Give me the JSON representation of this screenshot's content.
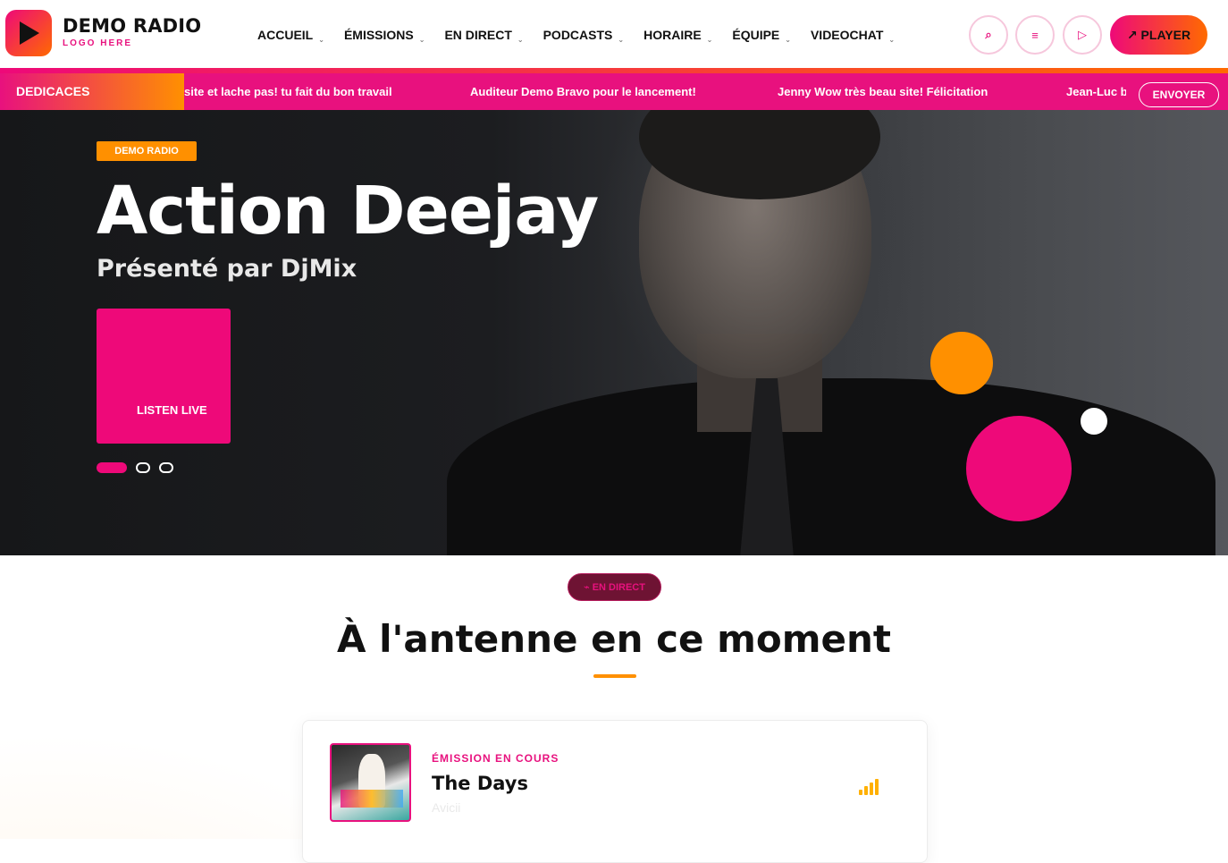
{
  "brand": {
    "name": "DEMO RADIO",
    "tagline": "LOGO HERE",
    "accent": "#e8117e",
    "accent2": "#ff9000"
  },
  "nav": [
    {
      "label": "ACCUEIL"
    },
    {
      "label": "ÉMISSIONS"
    },
    {
      "label": "EN DIRECT"
    },
    {
      "label": "PODCASTS"
    },
    {
      "label": "HORAIRE"
    },
    {
      "label": "ÉQUIPE"
    },
    {
      "label": "VIDEOCHAT"
    }
  ],
  "header_buttons": {
    "search_icon": "⌕",
    "menu_icon": "≡",
    "play_icon": "▷",
    "player_label": "↗ PLAYER"
  },
  "ticker": {
    "label": "DEDICACES",
    "messages": [
      "site et lache pas! tu fait du bon travail",
      "Auditeur Demo Bravo pour le lancement!",
      "Jenny Wow très beau site! Félicitation",
      "Jean-Luc beau"
    ],
    "send_label": "ENVOYER"
  },
  "hero": {
    "badge": "DEMO RADIO",
    "title": "Action Deejay",
    "subtitle": "Présenté par DjMix",
    "listen_label": "LISTEN LIVE",
    "slide_count": 3,
    "active_slide": 1
  },
  "section": {
    "pill_label": "⌁ EN DIRECT",
    "title": "À l'antenne en ce moment"
  },
  "now_playing": {
    "label": "ÉMISSION EN COURS",
    "title": "The Days",
    "artist": "Avicii",
    "cover_text": "THE DAYS / NIGHTS EP"
  }
}
